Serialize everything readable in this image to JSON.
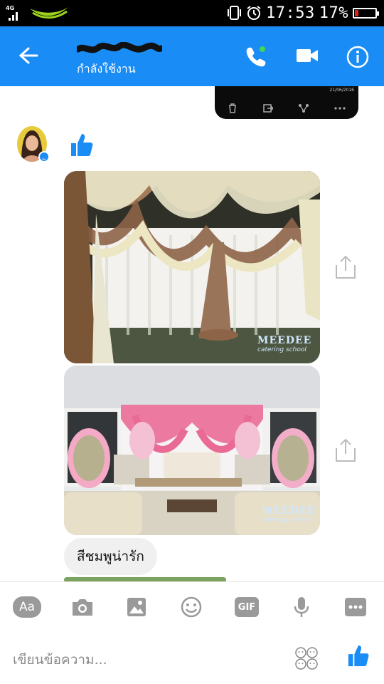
{
  "status_bar": {
    "network": "4G",
    "time": "17:53",
    "battery": "17%",
    "battery_level": 0.17,
    "battery_color": "#e0241a"
  },
  "header": {
    "contact_name": "",
    "contact_status": "กำลังใช้งาน",
    "accent": "#1a8cf5"
  },
  "video_preview": {
    "date": "21/06/2016"
  },
  "messages": [
    {
      "type": "like"
    },
    {
      "type": "photo",
      "watermark_title": "MEEDEE",
      "watermark_subtitle": "catering school"
    },
    {
      "type": "photo",
      "watermark_title": "MEEDEE",
      "watermark_subtitle": "catering school"
    },
    {
      "type": "text",
      "text": "สีชมพูน่ารัก"
    }
  ],
  "composer": {
    "placeholder": "เขียนข้อความ...",
    "aa_label": "Aa",
    "gif_label": "GIF"
  },
  "icons": [
    "back-arrow-icon",
    "phone-icon",
    "video-call-icon",
    "info-icon",
    "trash-icon",
    "export-icon",
    "share-icon",
    "more-icon",
    "like-icon",
    "camera-icon",
    "gallery-icon",
    "emoji-icon",
    "mic-icon",
    "stickers-icon"
  ]
}
